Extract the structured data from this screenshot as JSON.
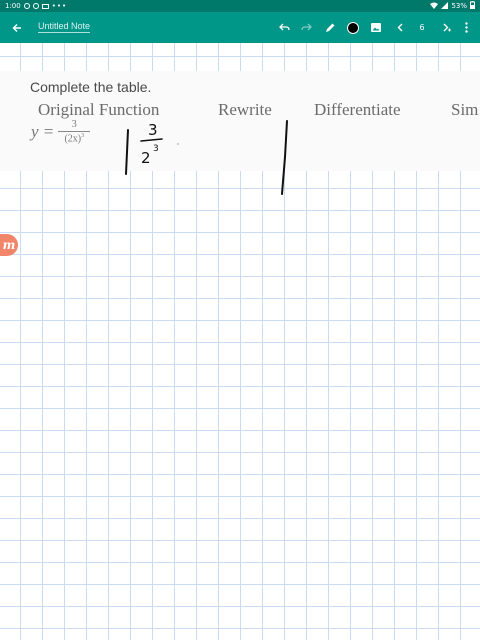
{
  "status_bar": {
    "time": "1:00",
    "battery": "53%",
    "more": "•••"
  },
  "app_bar": {
    "note_title": "Untitled Note",
    "page_number": "6"
  },
  "problem": {
    "instruction": "Complete the table.",
    "columns": [
      "Original Function",
      "Rewrite",
      "Differentiate",
      "Sim"
    ],
    "formula": {
      "lhs": "y =",
      "numerator": "3",
      "denominator": "(2x)",
      "exponent": "3"
    }
  },
  "handwriting": {
    "numerator": "3",
    "base": "2",
    "exponent": "3"
  },
  "colors": {
    "status_bar": "#00796b",
    "app_bar": "#009688",
    "grid": "#c9dcf4",
    "pen": "#000000",
    "badge": "#f2866a"
  },
  "badge": {
    "letter": "m"
  }
}
